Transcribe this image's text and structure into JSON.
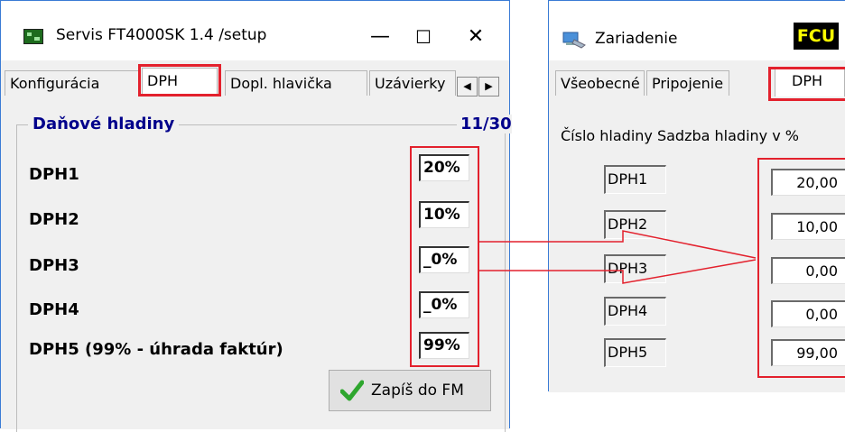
{
  "left_window": {
    "title": "Servis FT4000SK 1.4 /setup",
    "caption_buttons": [
      "—",
      "☐",
      "✕"
    ],
    "tabs": [
      "Konfigurácia",
      "DPH",
      "Dopl. hlavička",
      "Uzávierky"
    ],
    "active_tab": "DPH",
    "tab_scroll": [
      "◀",
      "▶"
    ],
    "group": {
      "title": "Daňové hladiny",
      "count": "11/30"
    },
    "rows": [
      {
        "label": "DPH1",
        "value": "20%"
      },
      {
        "label": "DPH2",
        "value": "10%"
      },
      {
        "label": "DPH3",
        "value": "_0%"
      },
      {
        "label": "DPH4",
        "value": "_0%"
      },
      {
        "label": "DPH5 (99% - úhrada faktúr)",
        "value": "99%"
      }
    ],
    "save_button": "Zapíš do FM"
  },
  "right_window": {
    "title": "Zariadenie",
    "badge": "FCU",
    "tabs": [
      "Všeobecné",
      "Pripojenie",
      "DPH"
    ],
    "active_tab": "DPH",
    "column_header": "Číslo hladiny Sadzba hladiny v %",
    "rows": [
      {
        "name": "DPH1",
        "rate": "20,00"
      },
      {
        "name": "DPH2",
        "rate": "10,00"
      },
      {
        "name": "DPH3",
        "rate": "0,00"
      },
      {
        "name": "DPH4",
        "rate": "0,00"
      },
      {
        "name": "DPH5",
        "rate": "99,00"
      }
    ]
  },
  "colors": {
    "highlight": "#e3212d",
    "group_title": "#00008b",
    "badge_bg": "#000000",
    "badge_text": "#ffff00",
    "check": "#2ea62e"
  },
  "icons": [
    "app-icon",
    "computer-icon",
    "checkmark-icon"
  ]
}
